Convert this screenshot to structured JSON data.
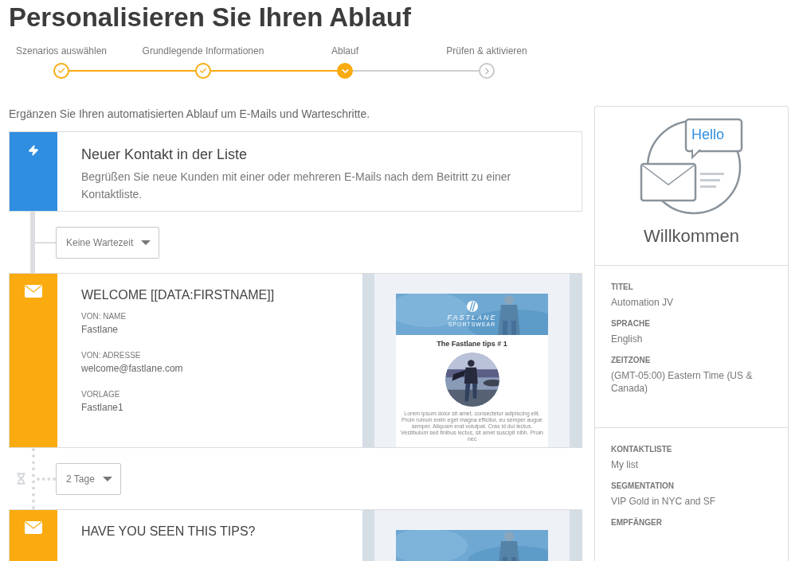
{
  "title": "Personalisieren Sie Ihren Ablauf",
  "steps": [
    {
      "label": "Szenarios auswählen",
      "done": true,
      "selected": false
    },
    {
      "label": "Grundlegende Informationen",
      "done": true,
      "selected": false
    },
    {
      "label": "Ablauf",
      "done": false,
      "selected": true
    },
    {
      "label": "Prüfen & aktivieren",
      "done": false,
      "selected": false
    }
  ],
  "intro": "Ergänzen Sie Ihren automatisierten Ablauf um E-Mails und Warteschritte.",
  "flow": [
    {
      "kind": "trigger",
      "title": "Neuer Kontakt in der Liste",
      "description": "Begrüßen Sie neue Kunden mit einer oder mehreren E-Mails nach dem Beitritt zu einer Kontaktliste."
    },
    {
      "kind": "wait",
      "value": "Keine Wartezeit"
    },
    {
      "kind": "email",
      "title": "WELCOME [[DATA:FIRSTNAME]]",
      "fields": [
        {
          "label": "VON: NAME",
          "value": "Fastlane"
        },
        {
          "label": "VON: ADRESSE",
          "value": "welcome@fastlane.com"
        },
        {
          "label": "VORLAGE",
          "value": "Fastlane1"
        }
      ],
      "preview": {
        "brand": "FASTLANE",
        "tagline": "SPORTSWEAR",
        "heading": "The Fastlane tips # 1",
        "body": "Lorem ipsum dolor sit amet, consectetur adipiscing elit. Proin rutrum enim eget magna efficitur, eu semper augue semper. Aliquam erat volutpat. Cras id dui lectus. Vestibulum sed finibus lectus, sit amet suscipit nibh. Proin nec"
      }
    },
    {
      "kind": "delay",
      "value": "2 Tage"
    },
    {
      "kind": "email",
      "title": "HAVE YOU SEEN THIS TIPS?"
    }
  ],
  "summary": {
    "bubble": "Hello",
    "heading": "Willkommen",
    "sections": [
      [
        {
          "label": "TITEL",
          "value": "Automation JV"
        },
        {
          "label": "SPRACHE",
          "value": "English"
        },
        {
          "label": "ZEITZONE",
          "value": "(GMT-05:00) Eastern Time (US & Canada)"
        }
      ],
      [
        {
          "label": "KONTAKTLISTE",
          "value": "My list"
        },
        {
          "label": "SEGMENTATION",
          "value": "VIP Gold in NYC and SF"
        },
        {
          "label": "EMPFÄNGER"
        }
      ]
    ]
  }
}
